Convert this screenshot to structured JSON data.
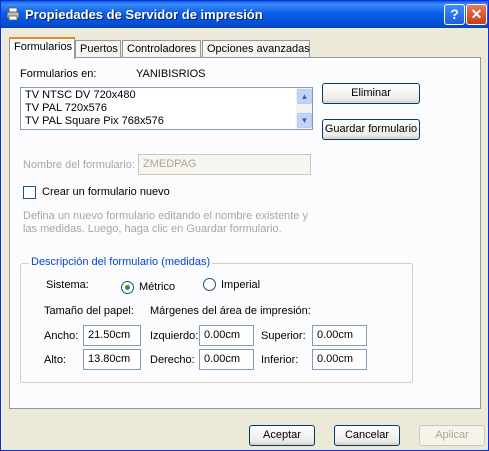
{
  "window": {
    "title": "Propiedades de Servidor de impresión",
    "help_glyph": "?",
    "close_glyph": "✕"
  },
  "tabs": [
    {
      "label": "Formularios",
      "active": true
    },
    {
      "label": "Puertos"
    },
    {
      "label": "Controladores"
    },
    {
      "label": "Opciones avanzadas"
    }
  ],
  "forms_on": {
    "label": "Formularios en:",
    "value": "YANIBISRIOS"
  },
  "forms_list": [
    "TV NTSC DV 720x480",
    "TV PAL 720x576",
    "TV PAL Square Pix 768x576"
  ],
  "buttons": {
    "delete": "Eliminar",
    "save_form": "Guardar formulario"
  },
  "form_name": {
    "label": "Nombre del formulario:",
    "value": "ZMEDPAG"
  },
  "create_new": {
    "label": "Crear un formulario nuevo",
    "checked": false
  },
  "hint": {
    "line1": "Defina un nuevo formulario editando el nombre existente y",
    "line2": "las medidas. Luego, haga clic en Guardar formulario."
  },
  "measurements": {
    "title": "Descripción del formulario (medidas)",
    "system_label": "Sistema:",
    "metric": "Métrico",
    "imperial": "Imperial",
    "selected": "Métrico",
    "paper_size_label": "Tamaño del papel:",
    "margins_label": "Márgenes del área de impresión:",
    "width_label": "Ancho:",
    "width": "21.50cm",
    "height_label": "Alto:",
    "height": "13.80cm",
    "left_label": "Izquierdo:",
    "left": "0.00cm",
    "right_label": "Derecho:",
    "right": "0.00cm",
    "top_label": "Superior:",
    "top": "0.00cm",
    "bottom_label": "Inferior:",
    "bottom": "0.00cm"
  },
  "footer": {
    "ok": "Aceptar",
    "cancel": "Cancelar",
    "apply": "Aplicar"
  },
  "colors": {
    "title_bar": "#0a5ee8",
    "dialog_bg": "#ece9d8",
    "group_title": "#0046d5",
    "active_tab_accent": "#e68b2c"
  }
}
